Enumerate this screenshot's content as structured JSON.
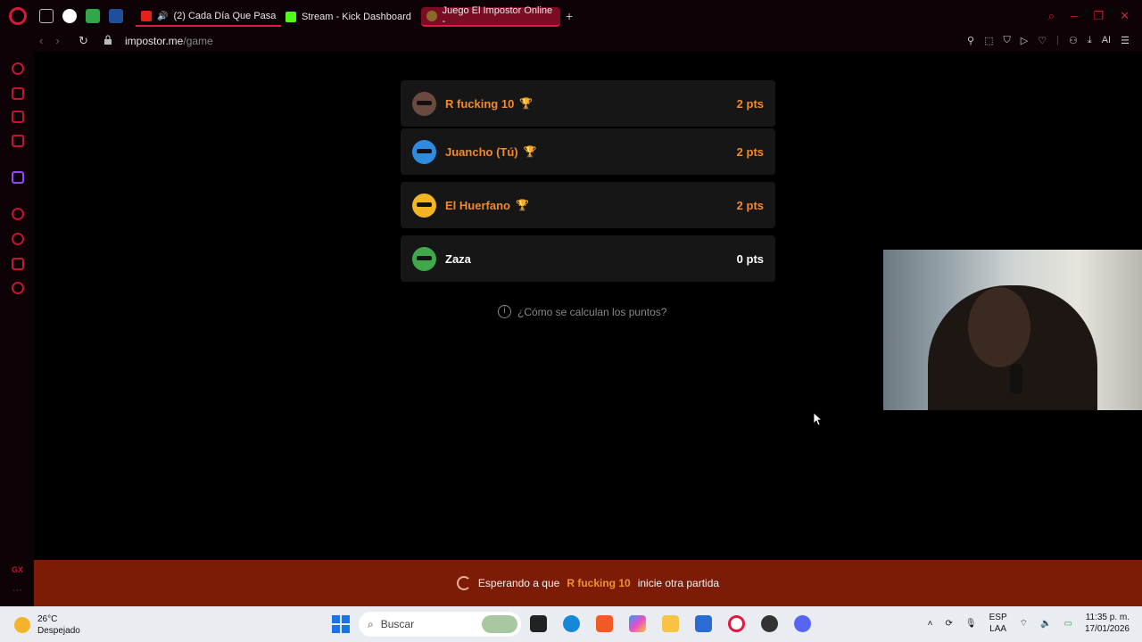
{
  "browser": {
    "tabs": [
      {
        "label": "(2) Cada Día Que Pasa",
        "favicon_color": "#e62117"
      },
      {
        "label": "Stream - Kick Dashboard",
        "favicon_color": "#53fc18"
      },
      {
        "label": "Juego El Impostor Online -",
        "favicon_color": "#8a6a2a"
      }
    ],
    "url_host": "impostor.me",
    "url_path": "/game",
    "toolbar_ai_label": "AI"
  },
  "players": [
    {
      "name": "R fucking 10",
      "trophy": "🏆",
      "points": "2 pts",
      "avatar_color": "#6a4a3e"
    },
    {
      "name": "Juancho (Tú)",
      "trophy": "🏆",
      "points": "2 pts",
      "avatar_color": "#2f8be0"
    },
    {
      "name": "El Huerfano",
      "trophy": "🏆",
      "points": "2 pts",
      "avatar_color": "#f0b424"
    },
    {
      "name": "Zaza",
      "trophy": "",
      "points": "0 pts",
      "avatar_color": "#3ea84a"
    }
  ],
  "help_link": "¿Cómo se calculan los puntos?",
  "status": {
    "prefix": "Esperando a que",
    "player": "R fucking 10",
    "suffix": "inicie otra partida"
  },
  "taskbar": {
    "weather_temp": "26°C",
    "weather_desc": "Despejado",
    "search_placeholder": "Buscar",
    "lang_1": "ESP",
    "lang_2": "LAA",
    "time": "11:35 p. m.",
    "date": "17/01/2026"
  },
  "sidebar_label": "GX",
  "colors": {
    "accent": "#d3193a",
    "player_highlight": "#f08a2a",
    "status_bar": "#7c1c06"
  }
}
